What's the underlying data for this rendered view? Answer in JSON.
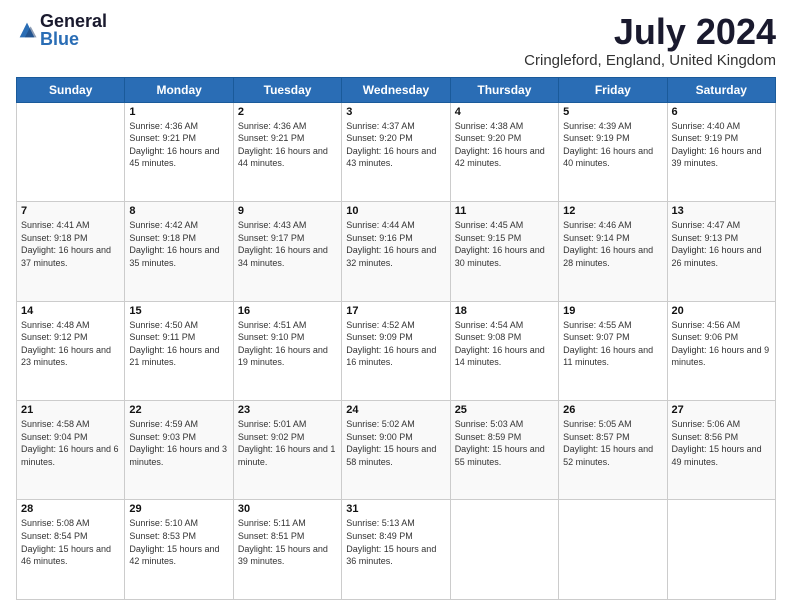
{
  "logo": {
    "general": "General",
    "blue": "Blue"
  },
  "title": "July 2024",
  "location": "Cringleford, England, United Kingdom",
  "days_of_week": [
    "Sunday",
    "Monday",
    "Tuesday",
    "Wednesday",
    "Thursday",
    "Friday",
    "Saturday"
  ],
  "weeks": [
    [
      {
        "day": "",
        "info": ""
      },
      {
        "day": "1",
        "info": "Sunrise: 4:36 AM\nSunset: 9:21 PM\nDaylight: 16 hours and 45 minutes."
      },
      {
        "day": "2",
        "info": "Sunrise: 4:36 AM\nSunset: 9:21 PM\nDaylight: 16 hours and 44 minutes."
      },
      {
        "day": "3",
        "info": "Sunrise: 4:37 AM\nSunset: 9:20 PM\nDaylight: 16 hours and 43 minutes."
      },
      {
        "day": "4",
        "info": "Sunrise: 4:38 AM\nSunset: 9:20 PM\nDaylight: 16 hours and 42 minutes."
      },
      {
        "day": "5",
        "info": "Sunrise: 4:39 AM\nSunset: 9:19 PM\nDaylight: 16 hours and 40 minutes."
      },
      {
        "day": "6",
        "info": "Sunrise: 4:40 AM\nSunset: 9:19 PM\nDaylight: 16 hours and 39 minutes."
      }
    ],
    [
      {
        "day": "7",
        "info": "Sunrise: 4:41 AM\nSunset: 9:18 PM\nDaylight: 16 hours and 37 minutes."
      },
      {
        "day": "8",
        "info": "Sunrise: 4:42 AM\nSunset: 9:18 PM\nDaylight: 16 hours and 35 minutes."
      },
      {
        "day": "9",
        "info": "Sunrise: 4:43 AM\nSunset: 9:17 PM\nDaylight: 16 hours and 34 minutes."
      },
      {
        "day": "10",
        "info": "Sunrise: 4:44 AM\nSunset: 9:16 PM\nDaylight: 16 hours and 32 minutes."
      },
      {
        "day": "11",
        "info": "Sunrise: 4:45 AM\nSunset: 9:15 PM\nDaylight: 16 hours and 30 minutes."
      },
      {
        "day": "12",
        "info": "Sunrise: 4:46 AM\nSunset: 9:14 PM\nDaylight: 16 hours and 28 minutes."
      },
      {
        "day": "13",
        "info": "Sunrise: 4:47 AM\nSunset: 9:13 PM\nDaylight: 16 hours and 26 minutes."
      }
    ],
    [
      {
        "day": "14",
        "info": "Sunrise: 4:48 AM\nSunset: 9:12 PM\nDaylight: 16 hours and 23 minutes."
      },
      {
        "day": "15",
        "info": "Sunrise: 4:50 AM\nSunset: 9:11 PM\nDaylight: 16 hours and 21 minutes."
      },
      {
        "day": "16",
        "info": "Sunrise: 4:51 AM\nSunset: 9:10 PM\nDaylight: 16 hours and 19 minutes."
      },
      {
        "day": "17",
        "info": "Sunrise: 4:52 AM\nSunset: 9:09 PM\nDaylight: 16 hours and 16 minutes."
      },
      {
        "day": "18",
        "info": "Sunrise: 4:54 AM\nSunset: 9:08 PM\nDaylight: 16 hours and 14 minutes."
      },
      {
        "day": "19",
        "info": "Sunrise: 4:55 AM\nSunset: 9:07 PM\nDaylight: 16 hours and 11 minutes."
      },
      {
        "day": "20",
        "info": "Sunrise: 4:56 AM\nSunset: 9:06 PM\nDaylight: 16 hours and 9 minutes."
      }
    ],
    [
      {
        "day": "21",
        "info": "Sunrise: 4:58 AM\nSunset: 9:04 PM\nDaylight: 16 hours and 6 minutes."
      },
      {
        "day": "22",
        "info": "Sunrise: 4:59 AM\nSunset: 9:03 PM\nDaylight: 16 hours and 3 minutes."
      },
      {
        "day": "23",
        "info": "Sunrise: 5:01 AM\nSunset: 9:02 PM\nDaylight: 16 hours and 1 minute."
      },
      {
        "day": "24",
        "info": "Sunrise: 5:02 AM\nSunset: 9:00 PM\nDaylight: 15 hours and 58 minutes."
      },
      {
        "day": "25",
        "info": "Sunrise: 5:03 AM\nSunset: 8:59 PM\nDaylight: 15 hours and 55 minutes."
      },
      {
        "day": "26",
        "info": "Sunrise: 5:05 AM\nSunset: 8:57 PM\nDaylight: 15 hours and 52 minutes."
      },
      {
        "day": "27",
        "info": "Sunrise: 5:06 AM\nSunset: 8:56 PM\nDaylight: 15 hours and 49 minutes."
      }
    ],
    [
      {
        "day": "28",
        "info": "Sunrise: 5:08 AM\nSunset: 8:54 PM\nDaylight: 15 hours and 46 minutes."
      },
      {
        "day": "29",
        "info": "Sunrise: 5:10 AM\nSunset: 8:53 PM\nDaylight: 15 hours and 42 minutes."
      },
      {
        "day": "30",
        "info": "Sunrise: 5:11 AM\nSunset: 8:51 PM\nDaylight: 15 hours and 39 minutes."
      },
      {
        "day": "31",
        "info": "Sunrise: 5:13 AM\nSunset: 8:49 PM\nDaylight: 15 hours and 36 minutes."
      },
      {
        "day": "",
        "info": ""
      },
      {
        "day": "",
        "info": ""
      },
      {
        "day": "",
        "info": ""
      }
    ]
  ]
}
